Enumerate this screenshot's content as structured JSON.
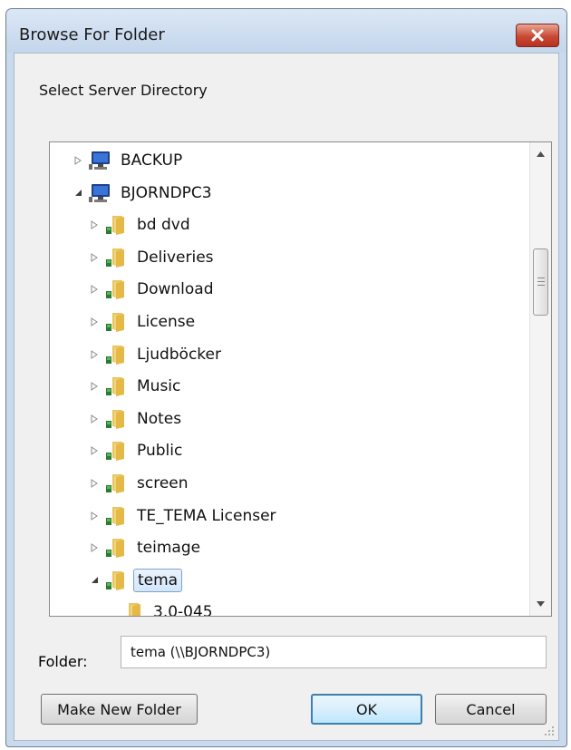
{
  "window": {
    "title": "Browse For Folder"
  },
  "dialog": {
    "prompt": "Select Server Directory",
    "folder_label": "Folder:",
    "folder_value": "tema (\\\\BJORNDPC3)",
    "buttons": {
      "make_new_folder": "Make New Folder",
      "ok": "OK",
      "cancel": "Cancel"
    }
  },
  "tree": {
    "items": [
      {
        "label": "BACKUP",
        "type": "computer",
        "expander": "collapsed"
      },
      {
        "label": "BJORNDPC3",
        "type": "computer",
        "expander": "expanded"
      },
      {
        "label": "bd dvd",
        "type": "shared-folder",
        "expander": "collapsed"
      },
      {
        "label": "Deliveries",
        "type": "shared-folder",
        "expander": "collapsed"
      },
      {
        "label": "Download",
        "type": "shared-folder",
        "expander": "collapsed"
      },
      {
        "label": "License",
        "type": "shared-folder",
        "expander": "collapsed"
      },
      {
        "label": "Ljudböcker",
        "type": "shared-folder",
        "expander": "collapsed"
      },
      {
        "label": "Music",
        "type": "shared-folder",
        "expander": "collapsed"
      },
      {
        "label": "Notes",
        "type": "shared-folder",
        "expander": "collapsed"
      },
      {
        "label": "Public",
        "type": "shared-folder",
        "expander": "collapsed"
      },
      {
        "label": "screen",
        "type": "shared-folder",
        "expander": "collapsed"
      },
      {
        "label": "TE_TEMA Licenser",
        "type": "shared-folder",
        "expander": "collapsed"
      },
      {
        "label": "teimage",
        "type": "shared-folder",
        "expander": "collapsed"
      },
      {
        "label": "tema",
        "type": "shared-folder",
        "expander": "expanded",
        "selected": true
      },
      {
        "label": "3.0-045",
        "type": "folder",
        "expander": "none"
      }
    ]
  },
  "icons": {
    "close": "close-icon",
    "computer": "computer-icon",
    "shared-folder": "shared-folder-icon",
    "folder": "folder-icon",
    "expander_collapsed": "triangle-right-icon",
    "expander_expanded": "triangle-down-icon"
  },
  "colors": {
    "selection": "#d2e6fb",
    "default_button_border": "#3c7fb1",
    "close_button": "#c94a36"
  }
}
